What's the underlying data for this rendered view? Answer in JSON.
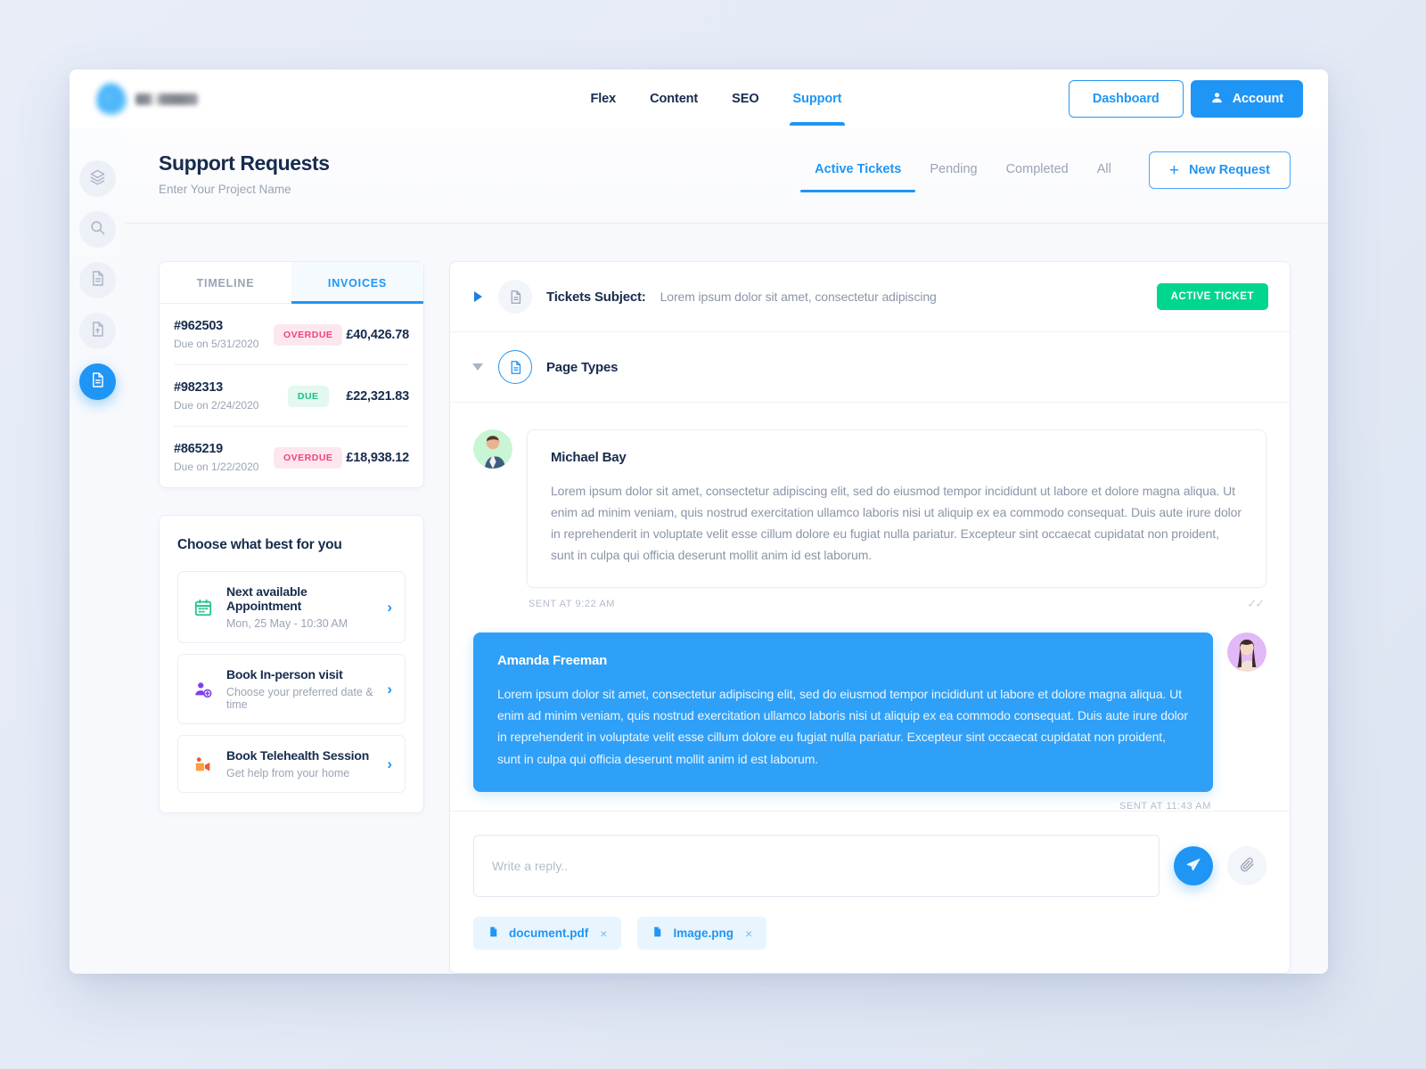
{
  "nav": {
    "links": [
      {
        "label": "Flex",
        "active": false
      },
      {
        "label": "Content",
        "active": false
      },
      {
        "label": "SEO",
        "active": false
      },
      {
        "label": "Support",
        "active": true
      }
    ],
    "dashboard_label": "Dashboard",
    "account_label": "Account"
  },
  "rail": {
    "items": [
      {
        "icon": "layers-icon",
        "active": false
      },
      {
        "icon": "search-icon",
        "active": false
      },
      {
        "icon": "document-icon",
        "active": false
      },
      {
        "icon": "document-upload-icon",
        "active": false
      },
      {
        "icon": "document-active-icon",
        "active": true
      }
    ]
  },
  "page": {
    "title": "Support Requests",
    "subtitle": "Enter Your Project Name",
    "tabs": [
      {
        "label": "Active Tickets",
        "active": true
      },
      {
        "label": "Pending",
        "active": false
      },
      {
        "label": "Completed",
        "active": false
      },
      {
        "label": "All",
        "active": false
      }
    ],
    "new_request_label": "New Request",
    "new_request_plus": "+"
  },
  "invoices": {
    "tabs": [
      {
        "label": "TIMELINE",
        "active": false
      },
      {
        "label": "INVOICES",
        "active": true
      }
    ],
    "rows": [
      {
        "id": "#962503",
        "due": "Due on 5/31/2020",
        "status": "OVERDUE",
        "status_kind": "overdue",
        "amount": "£40,426.78"
      },
      {
        "id": "#982313",
        "due": "Due on 2/24/2020",
        "status": "DUE",
        "status_kind": "due",
        "amount": "£22,321.83"
      },
      {
        "id": "#865219",
        "due": "Due on 1/22/2020",
        "status": "OVERDUE",
        "status_kind": "overdue",
        "amount": "£18,938.12"
      }
    ]
  },
  "choose": {
    "title": "Choose what best for you",
    "options": [
      {
        "icon": "calendar-icon",
        "title": "Next available Appointment",
        "subtitle": "Mon, 25 May - 10:30 AM",
        "arrow": "›"
      },
      {
        "icon": "person-add-icon",
        "title": "Book In-person visit",
        "subtitle": "Choose your preferred date & time",
        "arrow": "›"
      },
      {
        "icon": "telehealth-icon",
        "title": "Book Telehealth Session",
        "subtitle": "Get help from your home",
        "arrow": "›"
      }
    ]
  },
  "ticket": {
    "subject_label": "Tickets Subject:",
    "subject_text": "Lorem ipsum dolor sit amet, consectetur adipiscing",
    "status_badge": "ACTIVE TICKET",
    "section_label": "Page Types"
  },
  "messages": [
    {
      "name": "Michael Bay",
      "body": "Lorem ipsum dolor sit amet, consectetur adipiscing elit, sed do eiusmod tempor incididunt ut labore et dolore magna aliqua. Ut enim ad minim veniam, quis nostrud exercitation ullamco laboris nisi ut aliquip ex ea commodo consequat. Duis aute irure dolor in reprehenderit in voluptate velit esse cillum dolore eu fugiat nulla pariatur. Excepteur sint occaecat cupidatat non proident, sunt in culpa qui officia deserunt mollit anim id est laborum.",
      "time": "SENT AT 9:22 AM",
      "side": "left",
      "receipt": "✓✓"
    },
    {
      "name": "Amanda Freeman",
      "body": "Lorem ipsum dolor sit amet, consectetur adipiscing elit, sed do eiusmod tempor incididunt ut labore et dolore magna aliqua. Ut enim ad minim veniam, quis nostrud exercitation ullamco laboris nisi ut aliquip ex ea commodo consequat. Duis aute irure dolor in reprehenderit in voluptate velit esse cillum dolore eu fugiat nulla pariatur. Excepteur sint occaecat cupidatat non proident, sunt in culpa qui officia deserunt mollit anim id est laborum.",
      "time": "SENT AT 11:43 AM",
      "side": "right",
      "receipt": ""
    }
  ],
  "reply": {
    "placeholder": "Write a reply..",
    "value": "",
    "send_icon": "send-icon",
    "attach_icon": "paperclip-icon",
    "attachments": [
      {
        "name": "document.pdf",
        "remove": "×"
      },
      {
        "name": "Image.png",
        "remove": "×"
      }
    ]
  },
  "colors": {
    "accent": "#1f95f5",
    "success": "#00d68f",
    "danger": "#f2427a",
    "due": "#17c285",
    "bubble_blue": "#2fa0f7",
    "text_dark": "#172b4d",
    "text_muted": "#9aa4b4"
  }
}
